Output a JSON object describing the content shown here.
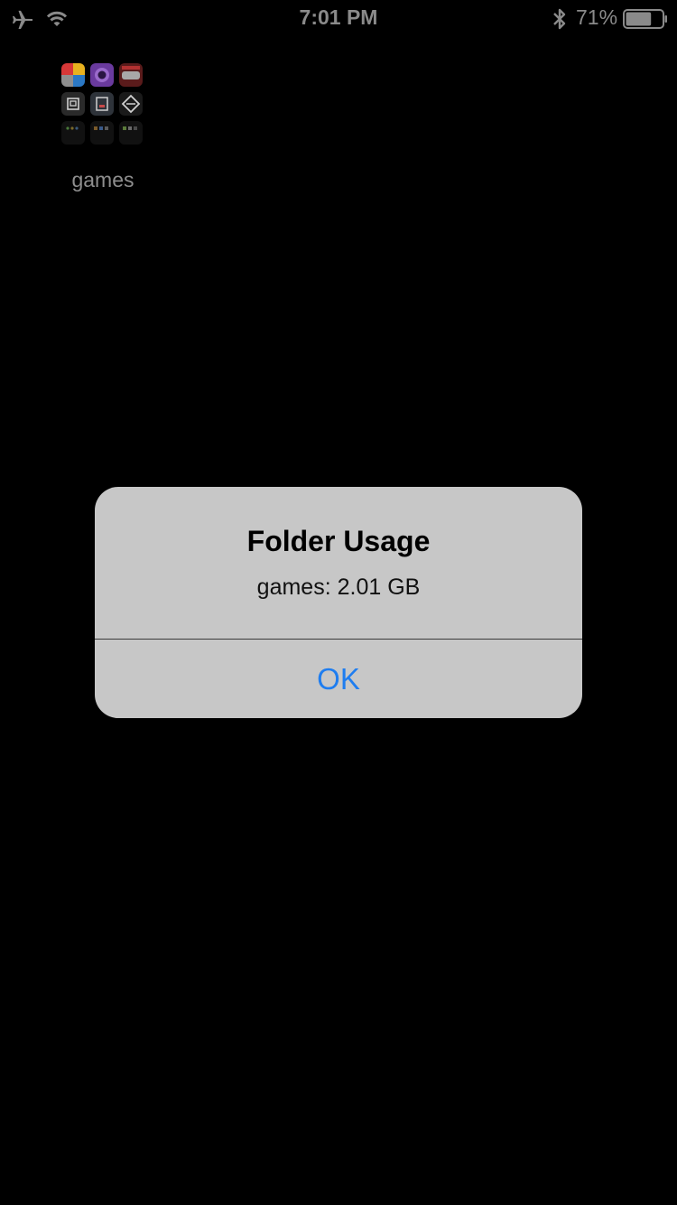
{
  "status_bar": {
    "time": "7:01 PM",
    "battery_percent_label": "71%",
    "battery_level": 0.71,
    "icons": [
      "airplane-icon",
      "wifi-icon",
      "bluetooth-icon",
      "battery-icon"
    ]
  },
  "home": {
    "folder": {
      "label": "games"
    }
  },
  "alert": {
    "title": "Folder Usage",
    "message": "games: 2.01 GB",
    "ok_label": "OK",
    "ok_color": "#1e7df0"
  }
}
